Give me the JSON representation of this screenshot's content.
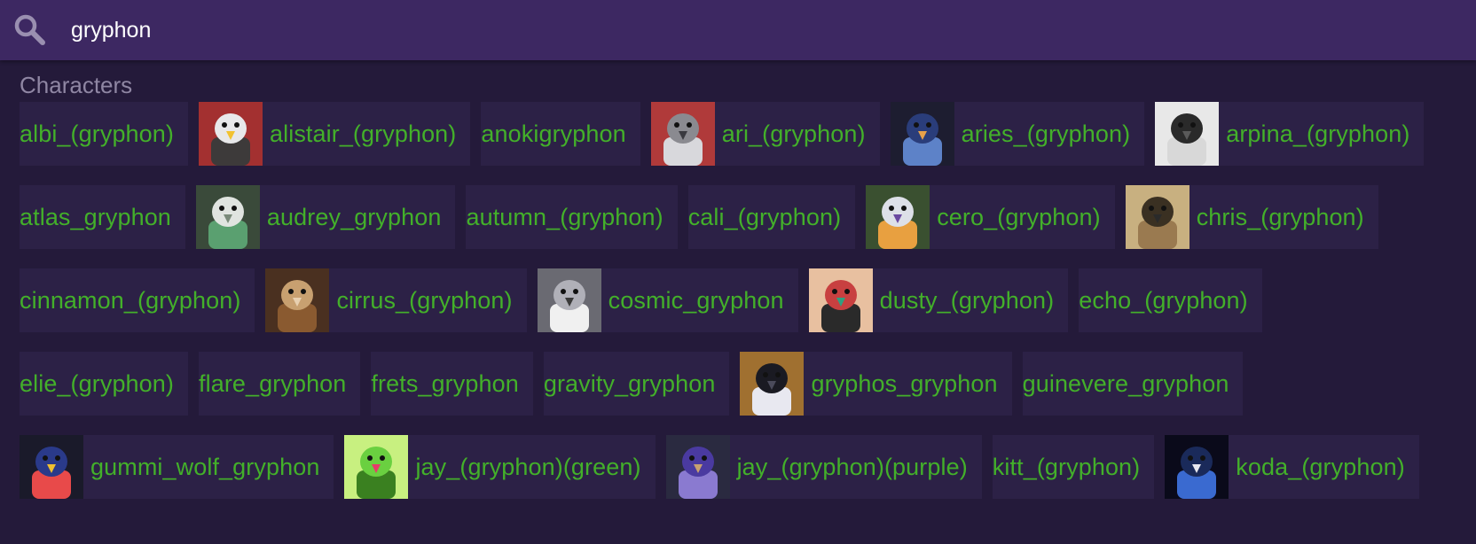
{
  "search": {
    "value": "gryphon",
    "icon": "search-icon"
  },
  "section": {
    "title": "Characters"
  },
  "colors": {
    "background": "#241a3a",
    "searchbar": "#3d2862",
    "chip_background": "#2c2146",
    "link": "#43b02a",
    "section_title": "#8f86a3"
  },
  "rows": [
    [
      {
        "label": "albi_(gryphon)",
        "thumb": false
      },
      {
        "label": "alistair_(gryphon)",
        "thumb": true,
        "palette": [
          "#e8e8ea",
          "#3d3a3a",
          "#f2c230",
          "#a33030"
        ]
      },
      {
        "label": "anokigryphon",
        "thumb": false
      },
      {
        "label": "ari_(gryphon)",
        "thumb": true,
        "palette": [
          "#8a8a90",
          "#d8d8dc",
          "#3a3a40",
          "#b03a3a"
        ]
      },
      {
        "label": "aries_(gryphon)",
        "thumb": true,
        "palette": [
          "#2a3d7a",
          "#5d82c8",
          "#e8a24a",
          "#1d1d30"
        ]
      },
      {
        "label": "arpina_(gryphon)",
        "thumb": true,
        "palette": [
          "#2a2a2a",
          "#d8d8d8",
          "#5a5a5a",
          "#e8e8e8"
        ]
      }
    ],
    [
      {
        "label": "atlas_gryphon",
        "thumb": false
      },
      {
        "label": "audrey_gryphon",
        "thumb": true,
        "palette": [
          "#e0e4e0",
          "#5aa070",
          "#7a8a7a",
          "#3a4a3a"
        ]
      },
      {
        "label": "autumn_(gryphon)",
        "thumb": false
      },
      {
        "label": "cali_(gryphon)",
        "thumb": false
      },
      {
        "label": "cero_(gryphon)",
        "thumb": true,
        "palette": [
          "#dde0e8",
          "#e8a040",
          "#6a48a0",
          "#3a5030"
        ]
      },
      {
        "label": "chris_(gryphon)",
        "thumb": true,
        "palette": [
          "#3a3022",
          "#9a7a50",
          "#2a2a2a",
          "#c8b080"
        ]
      }
    ],
    [
      {
        "label": "cinnamon_(gryphon)",
        "thumb": false
      },
      {
        "label": "cirrus_(gryphon)",
        "thumb": true,
        "palette": [
          "#c8a070",
          "#8a5a30",
          "#e8d0b0",
          "#4a3020"
        ]
      },
      {
        "label": "cosmic_gryphon",
        "thumb": true,
        "palette": [
          "#b0b0b8",
          "#f0f0f0",
          "#3a3a3a",
          "#6a6a72"
        ]
      },
      {
        "label": "dusty_(gryphon)",
        "thumb": true,
        "palette": [
          "#c84040",
          "#2a2a2a",
          "#30a080",
          "#e8c0a0"
        ]
      },
      {
        "label": "echo_(gryphon)",
        "thumb": false
      }
    ],
    [
      {
        "label": "elie_(gryphon)",
        "thumb": false
      },
      {
        "label": "flare_gryphon",
        "thumb": false
      },
      {
        "label": "frets_gryphon",
        "thumb": false
      },
      {
        "label": "gravity_gryphon",
        "thumb": false
      },
      {
        "label": "gryphos_gryphon",
        "thumb": true,
        "palette": [
          "#1a1a22",
          "#e8e8f0",
          "#4a4a5a",
          "#a07030"
        ]
      },
      {
        "label": "guinevere_gryphon",
        "thumb": false
      }
    ],
    [
      {
        "label": "gummi_wolf_gryphon",
        "thumb": true,
        "palette": [
          "#2a3a8a",
          "#e84a4a",
          "#f0c030",
          "#1a1a2a"
        ]
      },
      {
        "label": "jay_(gryphon)(green)",
        "thumb": true,
        "palette": [
          "#6ad040",
          "#3a8020",
          "#e83a6a",
          "#c8f080"
        ]
      },
      {
        "label": "jay_(gryphon)(purple)",
        "thumb": true,
        "palette": [
          "#4a3aa0",
          "#8a7ad0",
          "#c8a070",
          "#2a2a40"
        ]
      },
      {
        "label": "kitt_(gryphon)",
        "thumb": false
      },
      {
        "label": "koda_(gryphon)",
        "thumb": true,
        "palette": [
          "#1a2a5a",
          "#3a6ad0",
          "#e8e8f0",
          "#0a0a1a"
        ]
      }
    ]
  ]
}
